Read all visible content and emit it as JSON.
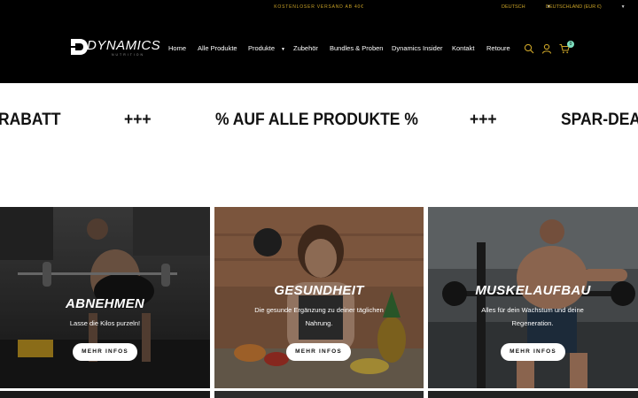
{
  "topbar": {
    "shipping_notice": "KOSTENLOSER VERSAND AB 40€",
    "language": "DEUTSCH",
    "country": "DEUTSCHLAND (EUR €)"
  },
  "logo": {
    "word": "DYNAMICS",
    "sub": "NUTRITION"
  },
  "nav": {
    "items": [
      "Home",
      "Alle Produkte",
      "Produkte",
      "Zubehör",
      "Bundles & Proben",
      "Dynamics Insider",
      "Kontakt",
      "Retoure"
    ]
  },
  "icons": {
    "search": "search-icon",
    "account": "user-icon",
    "cart": "cart-icon"
  },
  "cart": {
    "count": "0"
  },
  "marquee": {
    "items": [
      "RABATT",
      "+++",
      "% AUF ALLE PRODUKTE %",
      "+++",
      "SPAR-DEAL"
    ]
  },
  "tiles": [
    {
      "title": "ABNEHMEN",
      "subtitle": "Lasse die Kilos purzeln!",
      "button": "MEHR INFOS"
    },
    {
      "title": "GESUNDHEIT",
      "subtitle": "Die gesunde Ergänzung zu deiner täglichen Nahrung.",
      "button": "MEHR INFOS"
    },
    {
      "title": "MUSKELAUFBAU",
      "subtitle": "Alles für dein Wachstum und deine Regeneration.",
      "button": "MEHR INFOS"
    }
  ],
  "colors": {
    "header_bg": "#000000",
    "accent_gold": "#c9a227",
    "cart_badge": "#7ee0c0"
  }
}
